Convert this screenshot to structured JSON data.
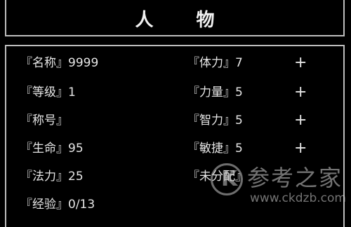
{
  "title": "人 物",
  "stats_left": [
    {
      "label": "『名称』9999"
    },
    {
      "label": "『等级』1"
    },
    {
      "label": "『称号』"
    },
    {
      "label": "『生命』95"
    },
    {
      "label": "『法力』25"
    },
    {
      "label": "『经验』0/13"
    }
  ],
  "stats_right": [
    {
      "label": "『体力』7",
      "button": "+"
    },
    {
      "label": "『力量』5",
      "button": "+"
    },
    {
      "label": "『智力』5",
      "button": "+"
    },
    {
      "label": "『敏捷』5",
      "button": "+"
    },
    {
      "label": "『未分配』"
    }
  ],
  "watermark": {
    "logo_letter": "K",
    "site_name": "参考之家",
    "url": "www.ckdzb.com"
  }
}
